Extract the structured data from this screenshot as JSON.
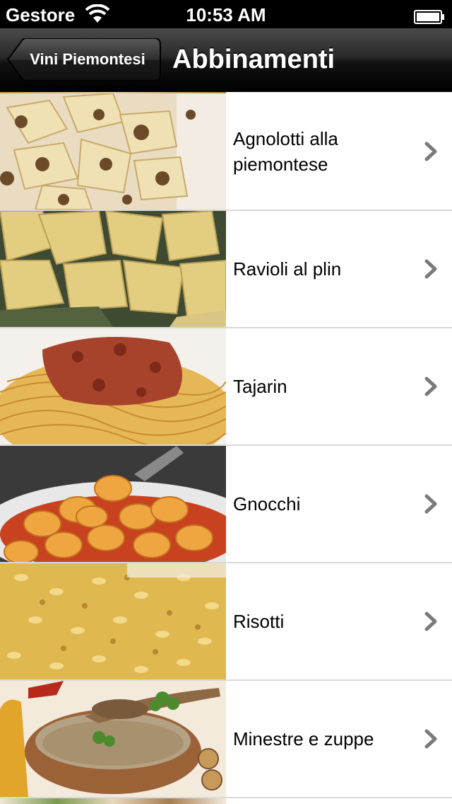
{
  "status_bar": {
    "carrier": "Gestore",
    "time": "10:53 AM",
    "wifi_icon": "wifi-icon",
    "battery_icon": "battery-icon"
  },
  "nav": {
    "back_label": "Vini Piemontesi",
    "title": "Abbinamenti"
  },
  "list": {
    "items": [
      {
        "label": "Agnolotti alla piemontese",
        "image": "agnolotti-photo"
      },
      {
        "label": "Ravioli al plin",
        "image": "ravioli-photo"
      },
      {
        "label": "Tajarin",
        "image": "tajarin-photo"
      },
      {
        "label": "Gnocchi",
        "image": "gnocchi-photo"
      },
      {
        "label": "Risotti",
        "image": "risotto-photo"
      },
      {
        "label": "Minestre e zuppe",
        "image": "soup-photo"
      }
    ],
    "chevron_icon": "chevron-right-icon"
  },
  "colors": {
    "nav_bar": "#1a1a1a",
    "separator": "#d9d9d9",
    "chevron": "#7a7a7a"
  }
}
